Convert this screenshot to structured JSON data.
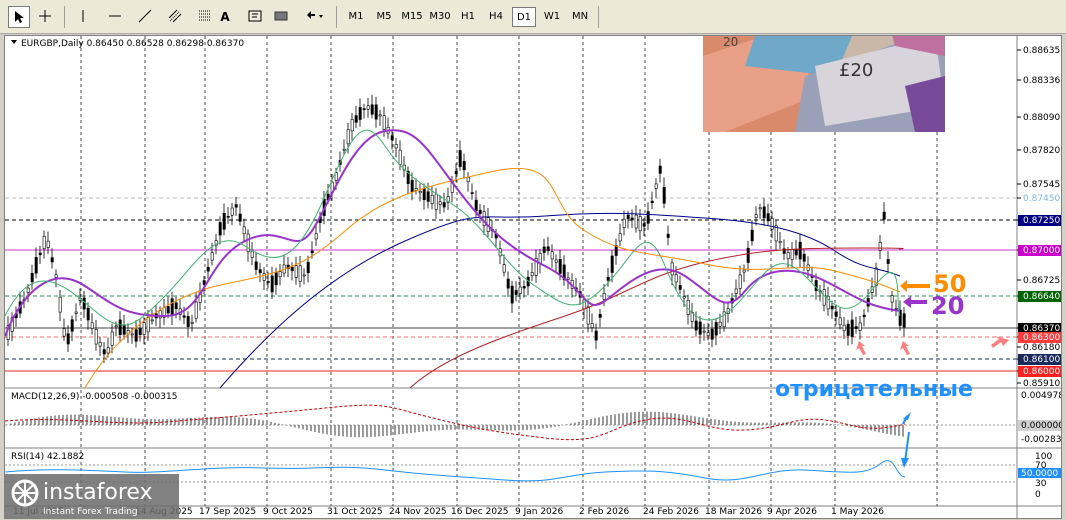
{
  "toolbar": {
    "timeframes": [
      "M1",
      "M5",
      "M15",
      "M30",
      "H1",
      "H4",
      "D1",
      "W1",
      "MN"
    ],
    "active_timeframe": "D1"
  },
  "chart": {
    "symbol_header": "EURGBP,Daily  0.86450 0.86528 0.86298 0.86370",
    "price_axis": [
      "0.88635",
      "0.88336",
      "0.88090",
      "0.87820",
      "0.87545",
      "0.87450",
      "0.87250",
      "0.87000",
      "0.86725",
      "0.86640",
      "0.86370",
      "0.86300",
      "0.86180",
      "0.86100",
      "0.86000",
      "0.85910"
    ],
    "highlighted_labels": [
      {
        "text": "0.87250",
        "bg": "#000080"
      },
      {
        "text": "0.87000",
        "bg": "#cc00cc"
      },
      {
        "text": "0.86640",
        "bg": "#006400"
      },
      {
        "text": "0.86370",
        "bg": "#000000"
      },
      {
        "text": "0.86300",
        "bg": "#ff3c3c"
      },
      {
        "text": "0.86100",
        "bg": "#1a2a5a"
      },
      {
        "text": "0.86000",
        "bg": "#ff2020"
      }
    ],
    "dates": [
      "11 Jul 2025",
      "14 Aug 2025",
      "17 Sep 2025",
      "9 Oct 2025",
      "31 Oct 2025",
      "24 Nov 2025",
      "16 Dec 2025",
      "9 Jan 2026",
      "2 Feb 2026",
      "24 Feb 2026",
      "18 Mar 2026",
      "9 Apr 2026",
      "1 May 2026"
    ],
    "annotations": {
      "ma50": "50",
      "ma20": "20",
      "negative": "отрицательные"
    }
  },
  "macd": {
    "header": "MACD(12,26,9) -0.000508 -0.000315",
    "axis": [
      "0.004978",
      "0.000000",
      "-0.002838"
    ]
  },
  "rsi": {
    "header": "RSI(14) 42.1882",
    "axis": [
      "100",
      "70",
      "50.0000",
      "30",
      "0"
    ]
  },
  "watermark": {
    "brand": "instaforex",
    "tagline": "Instant Forex Trading"
  },
  "colors": {
    "ma20": "#9933cc",
    "ma50": "#ff8c00",
    "negative": "#1e90ff",
    "signal": "#ff6b6b"
  }
}
